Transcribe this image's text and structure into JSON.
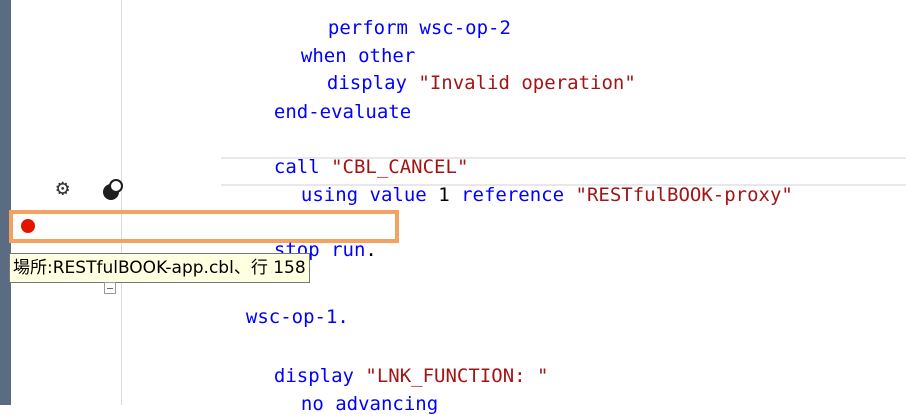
{
  "code": {
    "line0": "perform wsc-op-2",
    "when_kw": "when",
    "when_other": " other",
    "display_kw": "display",
    "invalid_str": "\"Invalid operation\"",
    "end_evaluate": "end-evaluate",
    "call_kw": "call",
    "cbl_cancel_str": "\"CBL_CANCEL\"",
    "using_kw": "using",
    "value_kw": "value",
    "one": "1",
    "reference_kw": "reference",
    "proxy_str": "\"RESTfulBOOK-proxy\"",
    "stop_kw": "stop run",
    "period": ".",
    "wsc_op_1": "wsc-op-1.",
    "display2_kw": "display",
    "lnk_function_str": "\"LNK_FUNCTION: \"",
    "no_advancing": "no advancing"
  },
  "tooltip": {
    "text": "場所:RESTfulBOOK-app.cbl、行 158"
  },
  "icons": {
    "gear": "gear-icon",
    "toggle": "breakpoint-toggle-icon",
    "breakpoint": "breakpoint-icon",
    "collapse": "collapse-icon"
  },
  "colors": {
    "keyword": "#0000ff",
    "string": "#a31515",
    "breakpoint": "#e51400",
    "highlight": "#f4a261",
    "tooltip_bg": "#ffffe1"
  }
}
